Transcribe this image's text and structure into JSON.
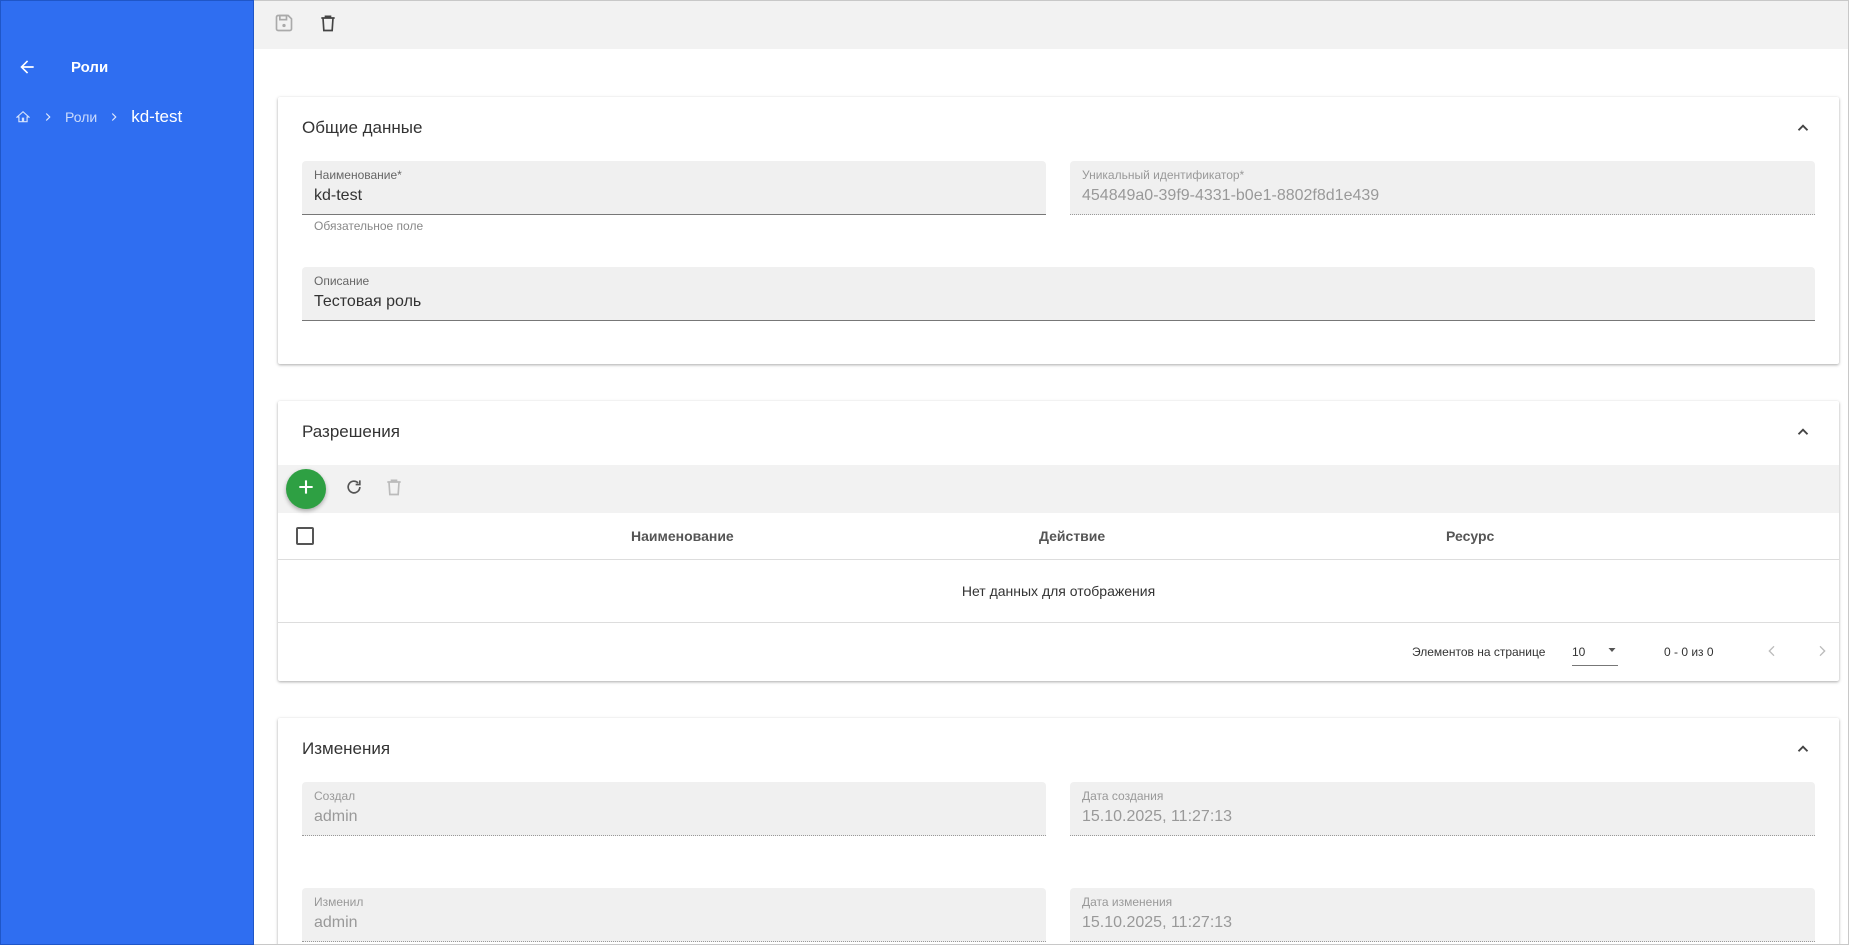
{
  "sidebar": {
    "title": "Роли",
    "breadcrumb": {
      "link": "Роли",
      "current": "kd-test"
    },
    "bg_color": "#2f6ef1"
  },
  "toolbar": {
    "icons": [
      "save-icon",
      "delete-icon"
    ]
  },
  "general": {
    "title": "Общие данные",
    "name_label": "Наименование*",
    "name_value": "kd-test",
    "name_hint": "Обязательное поле",
    "uid_label": "Уникальный идентификатор*",
    "uid_value": "454849a0-39f9-4331-b0e1-8802f8d1e439",
    "desc_label": "Описание",
    "desc_value": "Тестовая роль"
  },
  "permissions": {
    "title": "Разрешения",
    "columns": [
      "Наименование",
      "Действие",
      "Ресурс"
    ],
    "empty_text": "Нет данных для отображения",
    "paginator": {
      "items_per_page_label": "Элементов на странице",
      "page_size": "10",
      "range_label": "0 - 0 из 0"
    },
    "add_color": "#2ea043"
  },
  "changes": {
    "title": "Изменения",
    "created_by_label": "Создал",
    "created_by_value": "admin",
    "created_at_label": "Дата создания",
    "created_at_value": "15.10.2025, 11:27:13",
    "modified_by_label": "Изменил",
    "modified_by_value": "admin",
    "modified_at_label": "Дата изменения",
    "modified_at_value": "15.10.2025, 11:27:13"
  }
}
